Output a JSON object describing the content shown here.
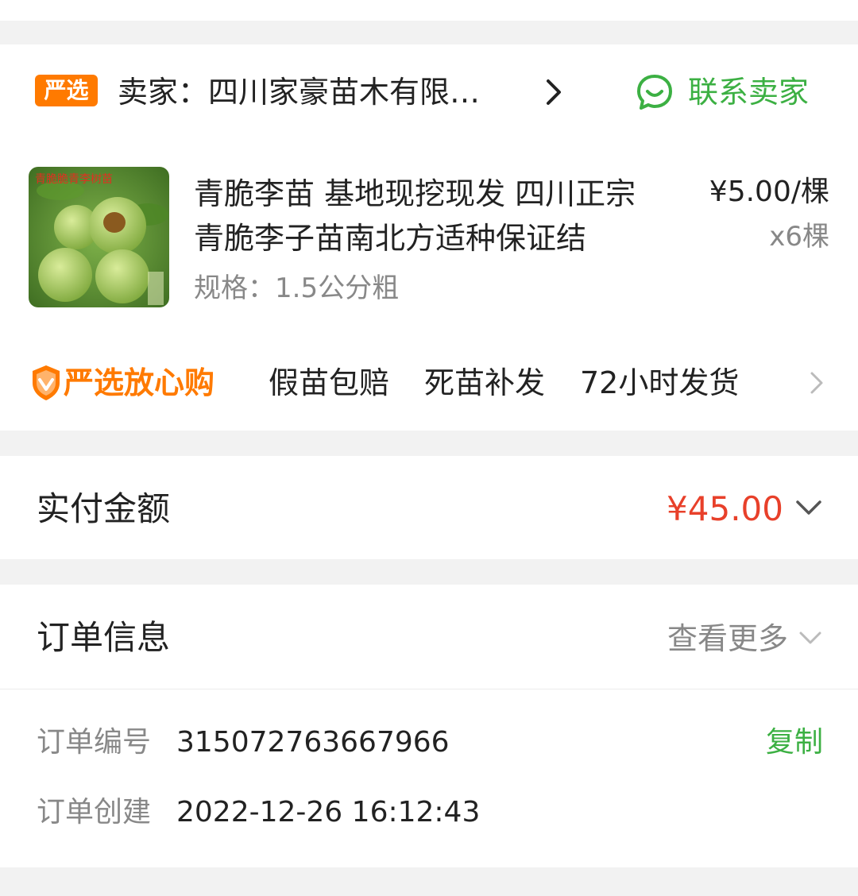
{
  "seller_card": {
    "badge": "严选",
    "seller_name": "卖家：四川家豪苗木有限…",
    "contact_label": "联系卖家",
    "product": {
      "title": "青脆李苗 基地现挖现发 四川正宗青脆李子苗南北方适种保证结",
      "spec": "规格：1.5公分粗",
      "price": "¥5.00/棵",
      "quantity": "x6棵",
      "image_caption": "青脆脆青李树苗"
    },
    "guarantee": {
      "brand": "严选放心购",
      "items": [
        "假苗包赔",
        "死苗补发",
        "72小时发货"
      ]
    }
  },
  "payment": {
    "label": "实付金额",
    "amount": "¥45.00"
  },
  "order_info": {
    "title": "订单信息",
    "more_label": "查看更多",
    "order_no_label": "订单编号",
    "order_no": "315072763667966",
    "copy_label": "复制",
    "created_label": "订单创建",
    "created_time": "2022-12-26 16:12:43"
  },
  "colors": {
    "accent_green": "#3cb043",
    "accent_orange": "#ff7a00",
    "price_red": "#e8402a",
    "background": "#f2f2f2"
  }
}
